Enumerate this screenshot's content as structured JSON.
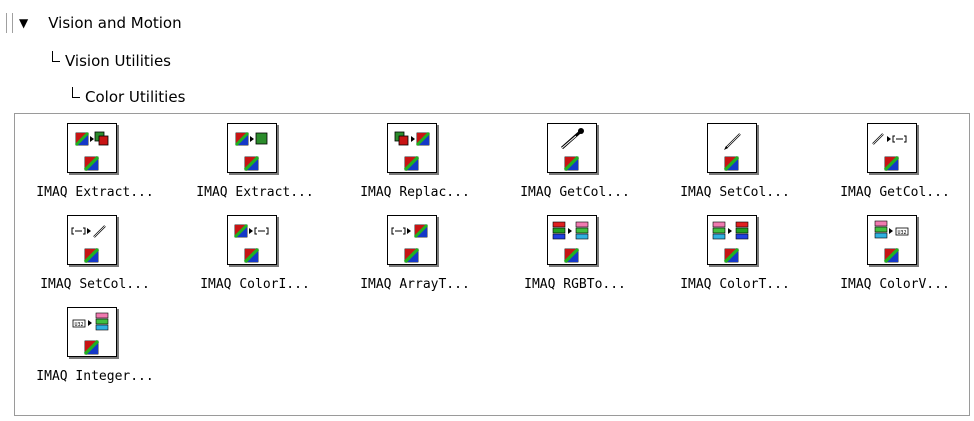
{
  "tree": {
    "level0": "Vision and Motion",
    "level1": "Vision Utilities",
    "level2": "Color Utilities"
  },
  "palette": {
    "items": [
      {
        "label": "IMAQ Extract...",
        "icon": "extract-color-plane-icon"
      },
      {
        "label": "IMAQ Extract...",
        "icon": "extract-single-plane-icon"
      },
      {
        "label": "IMAQ Replac...",
        "icon": "replace-color-plane-icon"
      },
      {
        "label": "IMAQ GetCol...",
        "icon": "eyedropper-icon"
      },
      {
        "label": "IMAQ SetCol...",
        "icon": "pencil-icon"
      },
      {
        "label": "IMAQ GetCol...",
        "icon": "pencil-to-array-icon"
      },
      {
        "label": "IMAQ SetCol...",
        "icon": "array-to-pencil-icon"
      },
      {
        "label": "IMAQ ColorI...",
        "icon": "color-image-to-array-icon"
      },
      {
        "label": "IMAQ ArrayT...",
        "icon": "array-to-color-image-icon"
      },
      {
        "label": "IMAQ RGBTo...",
        "icon": "rgb-to-color-icon"
      },
      {
        "label": "IMAQ ColorT...",
        "icon": "color-to-rgb-icon"
      },
      {
        "label": "IMAQ ColorV...",
        "icon": "color-value-to-integer-icon"
      },
      {
        "label": "IMAQ Integer...",
        "icon": "integer-to-color-value-icon"
      }
    ],
    "u32_text": "U32"
  }
}
